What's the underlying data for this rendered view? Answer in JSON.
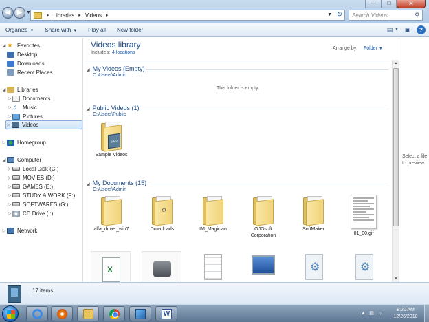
{
  "address": {
    "crumbs": [
      "Libraries",
      "Videos"
    ],
    "search_placeholder": "Search Videos"
  },
  "toolbar": {
    "organize": "Organize",
    "share_with": "Share with",
    "play_all": "Play all",
    "new_folder": "New folder",
    "help": "?"
  },
  "nav": {
    "favorites": "Favorites",
    "desktop": "Desktop",
    "downloads": "Downloads",
    "recent_places": "Recent Places",
    "libraries": "Libraries",
    "documents": "Documents",
    "music": "Music",
    "pictures": "Pictures",
    "videos": "Videos",
    "homegroup": "Homegroup",
    "computer": "Computer",
    "local_disk": "Local Disk (C:)",
    "movies": "MOVIES (D:)",
    "games": "GAMES (E:)",
    "study_work": "STUDY & WORK (F:)",
    "softwares": "SOFTWARES (G:)",
    "cd_drive": "CD Drive (I:)",
    "network": "Network"
  },
  "library": {
    "title": "Videos library",
    "includes_label": "Includes:",
    "includes_link": "4 locations",
    "arrange_label": "Arrange by:",
    "arrange_value": "Folder"
  },
  "groups": {
    "my_videos": {
      "title": "My Videos (Empty)",
      "path": "C:\\Users\\Admin",
      "empty_msg": "This folder is empty."
    },
    "public_videos": {
      "title": "Public Videos (1)",
      "path": "C:\\Users\\Public",
      "items": [
        "Sample Videos"
      ],
      "thumb_text": "WMV"
    },
    "my_documents": {
      "title": "My Documents (15)",
      "path": "C:\\Users\\Admin",
      "items": [
        "alfa_driver_win7",
        "Downloads",
        "IM_Magician",
        "OJOsoft Corporation",
        "SoftMaker",
        "01_00.gif"
      ]
    }
  },
  "preview": {
    "line1": "Select a file",
    "line2": "to preview."
  },
  "details": {
    "count": "17 items"
  },
  "taskbar": {
    "time": "8:20 AM",
    "date": "12/26/2010"
  },
  "colors": {
    "accent": "#1e4e8c",
    "link": "#1d5fb8",
    "selection": "#cde3f7"
  }
}
